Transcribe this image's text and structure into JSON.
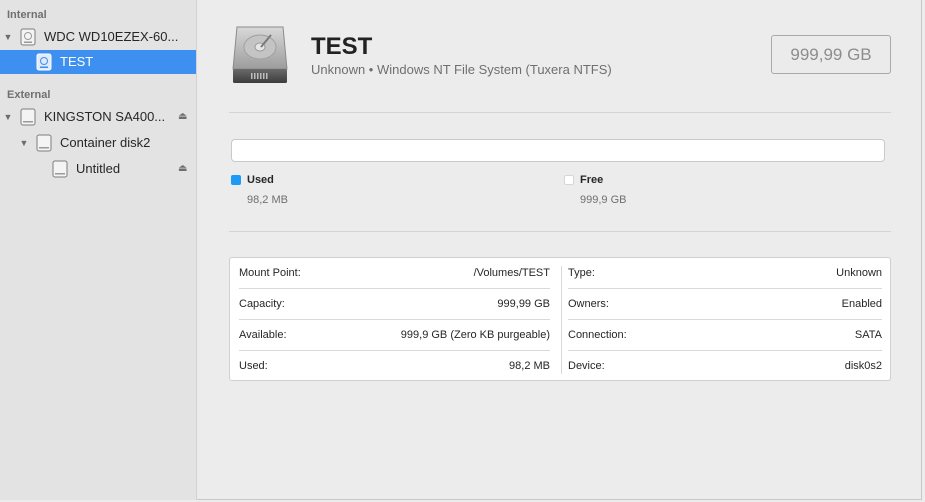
{
  "sidebar": {
    "internal_header": "Internal",
    "external_header": "External",
    "items": [
      {
        "label": "WDC WD10EZEX-60..."
      },
      {
        "label": "TEST"
      },
      {
        "label": "KINGSTON SA400..."
      },
      {
        "label": "Container disk2"
      },
      {
        "label": "Untitled"
      }
    ]
  },
  "volume": {
    "name": "TEST",
    "subtitle": "Unknown • Windows NT File System (Tuxera NTFS)",
    "size": "999,99 GB"
  },
  "usage": {
    "used_fraction": 0.0001,
    "used_label": "Used",
    "used_value": "98,2 MB",
    "free_label": "Free",
    "free_value": "999,9 GB",
    "used_color": "#1b9af7",
    "free_color": "#ffffff"
  },
  "info": {
    "left": [
      {
        "key": "Mount Point:",
        "value": "/Volumes/TEST"
      },
      {
        "key": "Capacity:",
        "value": "999,99 GB"
      },
      {
        "key": "Available:",
        "value": "999,9 GB (Zero KB purgeable)"
      },
      {
        "key": "Used:",
        "value": "98,2 MB"
      }
    ],
    "right": [
      {
        "key": "Type:",
        "value": "Unknown"
      },
      {
        "key": "Owners:",
        "value": "Enabled"
      },
      {
        "key": "Connection:",
        "value": "SATA"
      },
      {
        "key": "Device:",
        "value": "disk0s2"
      }
    ]
  },
  "colors": {
    "selection": "#3d8ff0",
    "sidebar_bg": "#e3e3e3",
    "main_bg": "#ececec"
  }
}
